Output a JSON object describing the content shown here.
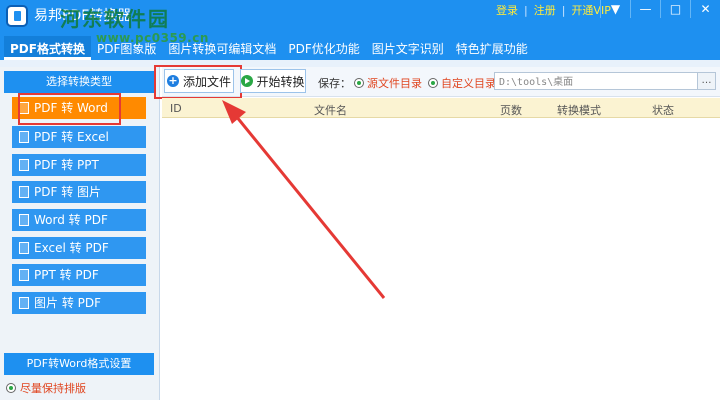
{
  "titlebar": {
    "app_title": "易邦PDF转换器",
    "watermark_title": "河东软件园",
    "watermark_url": "www.pc0359.cn",
    "links": {
      "login": "登录",
      "register": "注册",
      "vip": "开通VIP"
    },
    "window_buttons": {
      "menu": "▼",
      "minimize": "—",
      "maximize": "□",
      "close": "✕"
    }
  },
  "menu": {
    "tabs": [
      {
        "label": "PDF格式转换",
        "active": true
      },
      {
        "label": "PDF图象版"
      },
      {
        "label": "图片转换可编辑文档"
      },
      {
        "label": "PDF优化功能"
      },
      {
        "label": "图片文字识别"
      },
      {
        "label": "特色扩展功能"
      }
    ]
  },
  "sidebar": {
    "header": "选择转换类型",
    "items": [
      {
        "label": "PDF 转 Word",
        "active": true
      },
      {
        "label": "PDF 转 Excel"
      },
      {
        "label": "PDF 转 PPT"
      },
      {
        "label": "PDF 转 图片"
      },
      {
        "label": "Word 转 PDF"
      },
      {
        "label": "Excel 转 PDF"
      },
      {
        "label": "PPT  转 PDF"
      },
      {
        "label": "图片 转 PDF"
      }
    ],
    "settings_header": "PDF转Word格式设置",
    "settings_option": "尽量保持排版"
  },
  "toolbar": {
    "add_file": "添加文件",
    "start_convert": "开始转换",
    "save_label": "保存：",
    "save_source": "源文件目录",
    "save_custom": "自定义目录",
    "path_value": "D:\\tools\\桌面",
    "browse": "…"
  },
  "table": {
    "columns": [
      "ID",
      "文件名",
      "页数",
      "转换模式",
      "状态"
    ],
    "rows": []
  },
  "colors": {
    "titlebar": "#1e90f0",
    "active_item": "#ff8a00",
    "highlight": "#e53935",
    "vip_link": "#ffeb3b"
  }
}
